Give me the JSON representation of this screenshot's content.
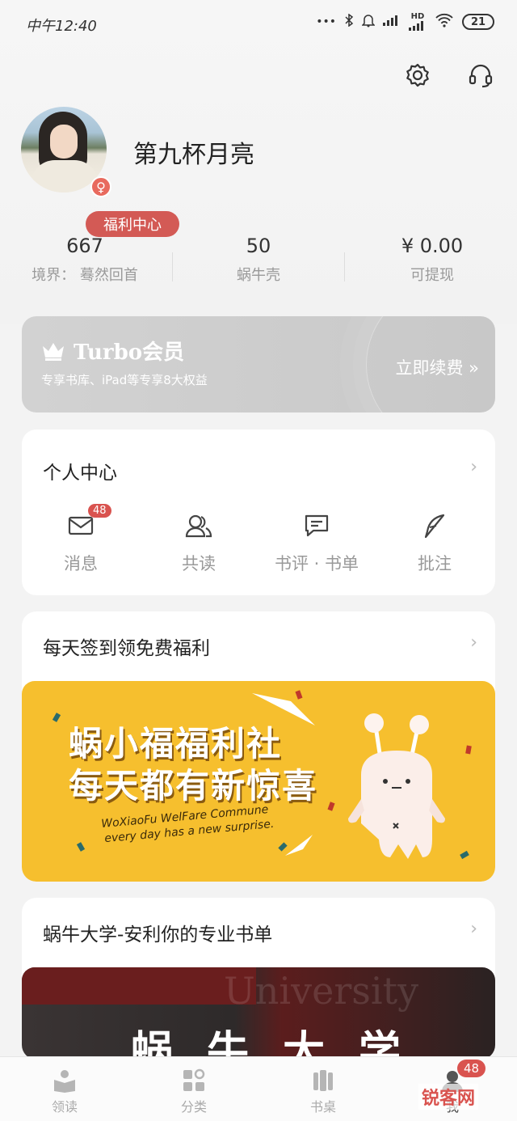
{
  "status_bar": {
    "time": "中午12:40",
    "dots": "•••",
    "battery": "21",
    "hd": "HD"
  },
  "profile": {
    "username": "第九杯月亮",
    "gender_symbol": "♀",
    "welfare_badge": "福利中心"
  },
  "stats": [
    {
      "value": "667",
      "label": "境界：  蓦然回首"
    },
    {
      "value": "50",
      "label": "蜗牛壳"
    },
    {
      "value": "¥ 0.00",
      "label": "可提现"
    }
  ],
  "turbo": {
    "title": "Turbo会员",
    "subtitle": "专享书库、iPad等专享8大权益",
    "renew": "立即续费 »"
  },
  "personal_center": {
    "title": "个人中心",
    "items": [
      {
        "label": "消息",
        "badge": "48",
        "icon": "mail-icon"
      },
      {
        "label": "共读",
        "icon": "people-icon"
      },
      {
        "label": "书评 · 书单",
        "icon": "comment-icon"
      },
      {
        "label": "批注",
        "icon": "quill-icon"
      }
    ]
  },
  "signin": {
    "title": "每天签到领免费福利",
    "banner_line1": "蜗小福福利社",
    "banner_line2": "每天都有新惊喜",
    "banner_en1": "WoXiaoFu WelFare Commune",
    "banner_en2": "every day has a new surprise."
  },
  "university": {
    "title": "蜗牛大学-安利你的专业书单",
    "banner_text": "蜗牛大学",
    "watermark": "University"
  },
  "tabbar": {
    "items": [
      {
        "label": "领读",
        "icon": "book-read-icon"
      },
      {
        "label": "分类",
        "icon": "category-icon"
      },
      {
        "label": "书桌",
        "icon": "bookshelf-icon"
      },
      {
        "label": "我",
        "icon": "profile-icon"
      }
    ],
    "me_badge": "48"
  },
  "watermark_text": "锐客网",
  "colors": {
    "accent": "#d9534f",
    "banner": "#f6bf2e",
    "turbo_bg": "#cccccc"
  }
}
